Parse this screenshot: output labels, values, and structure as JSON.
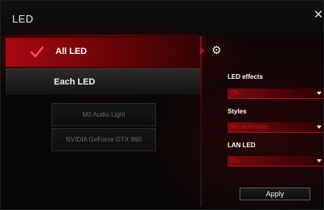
{
  "window": {
    "title": "LED",
    "close_icon": "close-icon"
  },
  "nav": {
    "all_led": {
      "label": "All LED",
      "selected": true,
      "icon": "check-icon"
    },
    "each_led": {
      "label": "Each LED"
    },
    "devices": [
      "M0 Audio Light",
      "NVIDIA GeForce GTX 960"
    ]
  },
  "settings": {
    "gear_icon": "gear-icon",
    "led_effects": {
      "label": "LED effects",
      "value": "On"
    },
    "styles": {
      "label": "Styles",
      "value": "No animation"
    },
    "lan_led": {
      "label": "LAN LED",
      "value": "On"
    },
    "apply_label": "Apply"
  },
  "colors": {
    "accent": "#c0141c",
    "background": "#060606",
    "text": "#ffffff"
  }
}
